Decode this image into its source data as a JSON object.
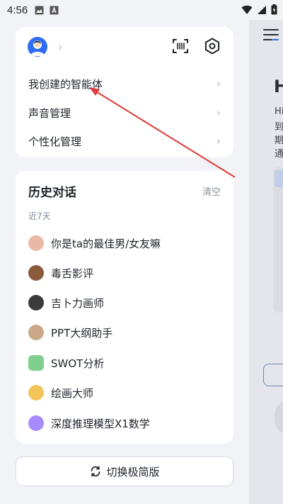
{
  "status_bar": {
    "time": "4:56"
  },
  "profile": {
    "avatar_icon": "user-avatar-icon",
    "scan_icon": "scan-icon",
    "settings_icon": "gear-icon"
  },
  "menu": {
    "items": [
      {
        "label": "我创建的智能体"
      },
      {
        "label": "声音管理"
      },
      {
        "label": "个性化管理"
      }
    ]
  },
  "history": {
    "title": "历史对话",
    "clear_label": "清空",
    "group_label": "近7天",
    "conversations": [
      {
        "label": "你是ta的最佳男/女友嘛",
        "color": "#e9b9a6"
      },
      {
        "label": "毒舌影评",
        "color": "#8a5a3c"
      },
      {
        "label": "吉卜力画师",
        "color": "#3b3b3b"
      },
      {
        "label": "PPT大纲助手",
        "color": "#c9a98a"
      },
      {
        "label": "SWOT分析",
        "color": "#7fcf8e"
      },
      {
        "label": "绘画大师",
        "color": "#f2c45a"
      },
      {
        "label": "深度推理模型X1数学",
        "color": "#a78bfa"
      }
    ]
  },
  "switch_button": {
    "label": "切换极简版"
  },
  "background_page": {
    "heading": "H",
    "lines": [
      "Hi",
      "到",
      "期",
      "通"
    ]
  },
  "colors": {
    "accent": "#2f6cf6",
    "annotation": "#e03b3b"
  }
}
